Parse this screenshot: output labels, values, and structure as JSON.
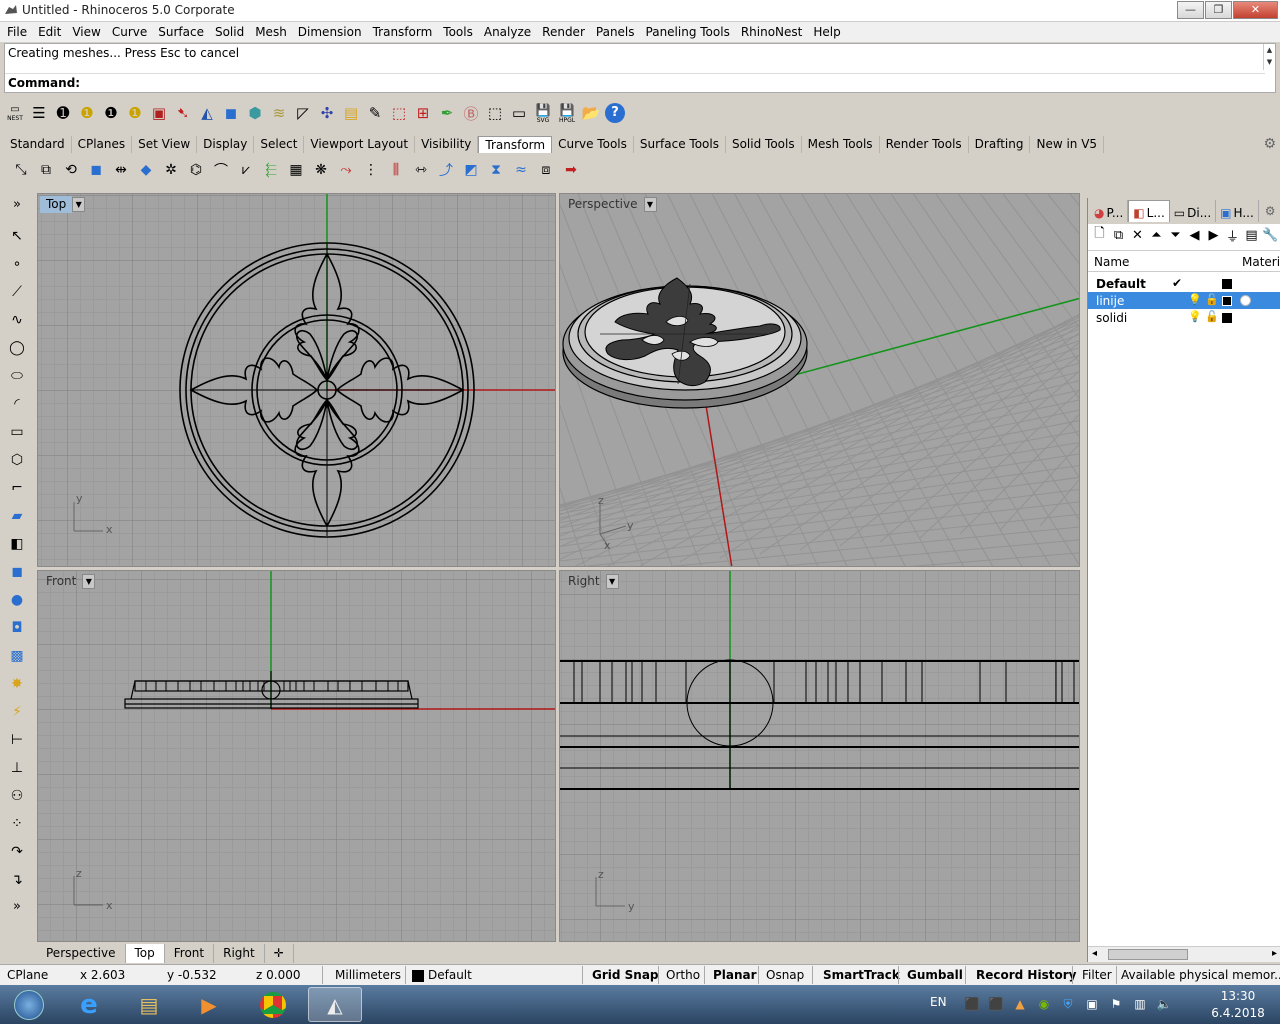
{
  "window": {
    "title": "Untitled - Rhinoceros  5.0 Corporate",
    "min": "—",
    "max": "❐",
    "close": "✕"
  },
  "menu": [
    "File",
    "Edit",
    "View",
    "Curve",
    "Surface",
    "Solid",
    "Mesh",
    "Dimension",
    "Transform",
    "Tools",
    "Analyze",
    "Render",
    "Panels",
    "Paneling Tools",
    "RhinoNest",
    "Help"
  ],
  "command": {
    "history": "Creating meshes... Press Esc to cancel",
    "prompt": "Command:"
  },
  "toolbar1": {
    "nest_label": "NEST",
    "svg_label": "SVG",
    "hpgl_label": "HPGL"
  },
  "tabs": [
    "Standard",
    "CPlanes",
    "Set View",
    "Display",
    "Select",
    "Viewport Layout",
    "Visibility",
    "Transform",
    "Curve Tools",
    "Surface Tools",
    "Solid Tools",
    "Mesh Tools",
    "Render Tools",
    "Drafting",
    "New in V5"
  ],
  "active_tab": "Transform",
  "viewports": {
    "top": {
      "label": "Top",
      "axis_x": "x",
      "axis_y": "y"
    },
    "perspective": {
      "label": "Perspective",
      "axis_x": "x",
      "axis_y": "y",
      "axis_z": "z"
    },
    "front": {
      "label": "Front",
      "axis_x": "x",
      "axis_z": "z"
    },
    "right": {
      "label": "Right",
      "axis_y": "y",
      "axis_z": "z"
    }
  },
  "viewport_tabs": [
    "Perspective",
    "Top",
    "Front",
    "Right"
  ],
  "viewport_tab_add": "✛",
  "active_viewport_tab": "Top",
  "panel": {
    "tabs": [
      "P...",
      "L...",
      "Di...",
      "H..."
    ],
    "columns": {
      "name": "Name",
      "material": "Material"
    },
    "layers": [
      {
        "name": "Default",
        "current": "✔",
        "selected": false
      },
      {
        "name": "linije",
        "current": "",
        "selected": true
      },
      {
        "name": "solidi",
        "current": "",
        "selected": false
      }
    ],
    "scroll_left": "◂",
    "scroll_right": "▸"
  },
  "status": {
    "cplane": "CPlane",
    "x": "x 2.603",
    "y": "y -0.532",
    "z": "z 0.000",
    "units": "Millimeters",
    "layer": "Default",
    "grid_snap": "Grid Snap",
    "ortho": "Ortho",
    "planar": "Planar",
    "osnap": "Osnap",
    "smarttrack": "SmartTrack",
    "gumball": "Gumball",
    "record_history": "Record History",
    "filter": "Filter",
    "memory": "Available physical memor..."
  },
  "taskbar": {
    "language": "EN",
    "time": "13:30",
    "date": "6.4.2018"
  },
  "colors": {
    "viewport_bg": "#a3a3a3",
    "grid_line": "#8e8e8e",
    "axis_x": "#b01818",
    "axis_y": "#12941a",
    "selection": "#3a8be0"
  }
}
